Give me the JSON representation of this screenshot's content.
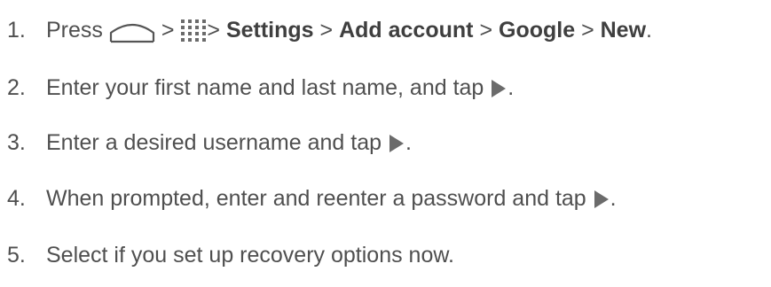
{
  "steps": [
    {
      "number": "1.",
      "press": "Press",
      "home_icon": "home-icon",
      "sep1": ">",
      "apps_icon": "apps-grid-icon",
      "sep2": ">",
      "settings": "Settings",
      "sep3": ">",
      "add_account": "Add account",
      "sep4": ">",
      "google": "Google",
      "sep5": ">",
      "new": "New",
      "end": "."
    },
    {
      "number": "2.",
      "text": "Enter your first name and last name, and tap",
      "icon": "next-arrow-icon",
      "end": "."
    },
    {
      "number": "3.",
      "text": "Enter a desired username and tap",
      "icon": "next-arrow-icon",
      "end": "."
    },
    {
      "number": "4.",
      "text": "When prompted, enter and reenter a password and tap",
      "icon": "next-arrow-icon",
      "end": "."
    },
    {
      "number": "5.",
      "text": "Select if you set up recovery options now."
    }
  ],
  "colors": {
    "text": "#4f4f4f",
    "icon": "#6b6b6b"
  }
}
